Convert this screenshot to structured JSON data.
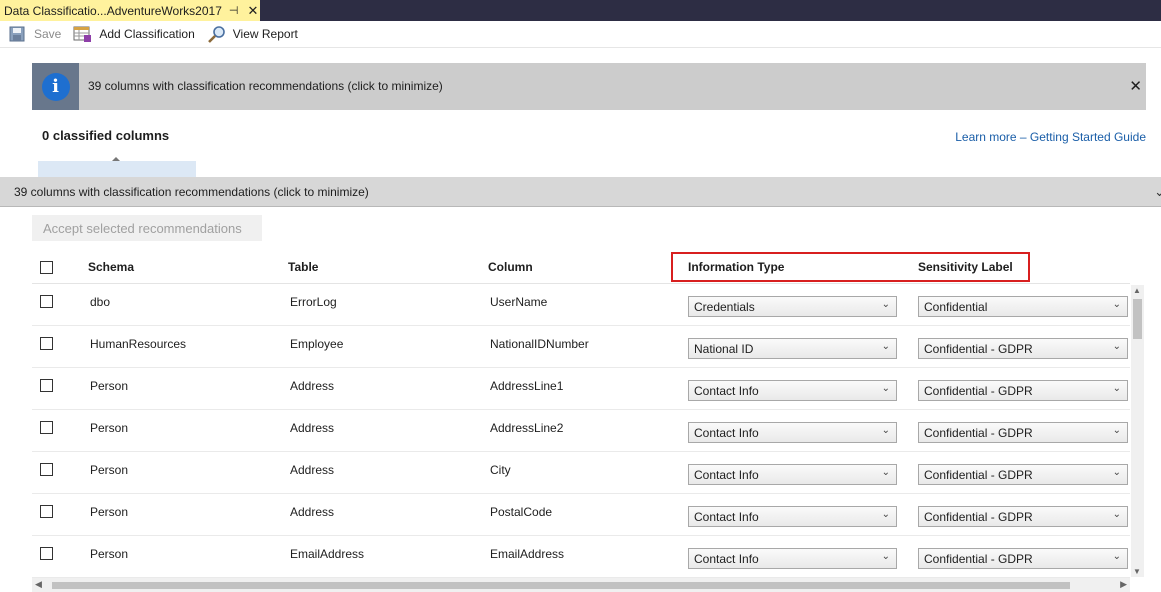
{
  "document_tab": {
    "title": "Data Classificatio...AdventureWorks2017",
    "pin_glyph": "⊣",
    "close_glyph": "✕"
  },
  "toolbar": {
    "save_label": "Save",
    "add_label": "Add Classification",
    "report_label": "View Report"
  },
  "banner": {
    "text": "39 columns with classification recommendations (click to minimize)",
    "close_glyph": "✕"
  },
  "summary": {
    "classified": "0 classified columns",
    "learn_more": "Learn more – Getting Started Guide"
  },
  "panel": {
    "header": "39 columns with classification recommendations (click to minimize)",
    "chevron": "⌄",
    "accept_label": "Accept selected recommendations"
  },
  "grid": {
    "columns": [
      "Schema",
      "Table",
      "Column",
      "Information Type",
      "Sensitivity Label"
    ],
    "rows": [
      {
        "schema": "dbo",
        "table": "ErrorLog",
        "column": "UserName",
        "info_type": "Credentials",
        "sensitivity": "Confidential"
      },
      {
        "schema": "HumanResources",
        "table": "Employee",
        "column": "NationalIDNumber",
        "info_type": "National ID",
        "sensitivity": "Confidential - GDPR"
      },
      {
        "schema": "Person",
        "table": "Address",
        "column": "AddressLine1",
        "info_type": "Contact Info",
        "sensitivity": "Confidential - GDPR"
      },
      {
        "schema": "Person",
        "table": "Address",
        "column": "AddressLine2",
        "info_type": "Contact Info",
        "sensitivity": "Confidential - GDPR"
      },
      {
        "schema": "Person",
        "table": "Address",
        "column": "City",
        "info_type": "Contact Info",
        "sensitivity": "Confidential - GDPR"
      },
      {
        "schema": "Person",
        "table": "Address",
        "column": "PostalCode",
        "info_type": "Contact Info",
        "sensitivity": "Confidential - GDPR"
      },
      {
        "schema": "Person",
        "table": "EmailAddress",
        "column": "EmailAddress",
        "info_type": "Contact Info",
        "sensitivity": "Confidential - GDPR"
      }
    ]
  },
  "icons": {
    "save": "save-icon",
    "add": "add-classification-icon",
    "report": "magnifier-icon",
    "info": "info-icon",
    "dropdown": "chevron-down-icon",
    "dropdown_glyph": "⌄",
    "info_glyph": "i"
  },
  "colors": {
    "tab_active": "#fff29d",
    "tab_strip": "#2d2d44",
    "banner": "#cccccc",
    "info_blue": "#1e6fd0",
    "highlight": "#d81f1f",
    "link": "#1a5ea8"
  }
}
